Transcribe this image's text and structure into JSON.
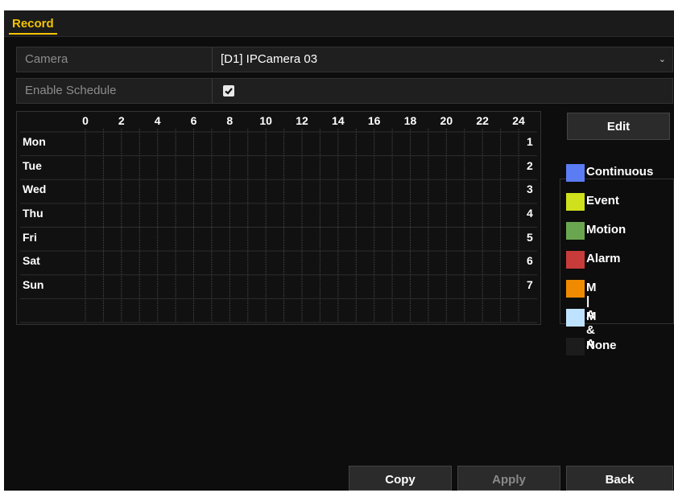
{
  "header": {
    "tab_label": "Record"
  },
  "camera": {
    "label": "Camera",
    "value": "[D1] IPCamera 03"
  },
  "enable_schedule": {
    "label": "Enable Schedule",
    "checked": true
  },
  "schedule": {
    "hour_labels": [
      "0",
      "2",
      "4",
      "6",
      "8",
      "10",
      "12",
      "14",
      "16",
      "18",
      "20",
      "22",
      "24"
    ],
    "days": [
      {
        "name": "Mon",
        "number": "1"
      },
      {
        "name": "Tue",
        "number": "2"
      },
      {
        "name": "Wed",
        "number": "3"
      },
      {
        "name": "Thu",
        "number": "4"
      },
      {
        "name": "Fri",
        "number": "5"
      },
      {
        "name": "Sat",
        "number": "6"
      },
      {
        "name": "Sun",
        "number": "7"
      }
    ]
  },
  "buttons": {
    "edit": "Edit",
    "copy": "Copy",
    "apply": "Apply",
    "back": "Back"
  },
  "legend": [
    {
      "label": "Continuous",
      "color": "#5b7cf2"
    },
    {
      "label": "Event",
      "color": "#cfe01c"
    },
    {
      "label": "Motion",
      "color": "#6aa64f"
    },
    {
      "label": "Alarm",
      "color": "#c83b3b"
    },
    {
      "label": "M | A",
      "color": "#f08a00"
    },
    {
      "label": "M & A",
      "color": "#bfe3ff"
    },
    {
      "label": "None",
      "color": "#1c1c1c"
    }
  ]
}
